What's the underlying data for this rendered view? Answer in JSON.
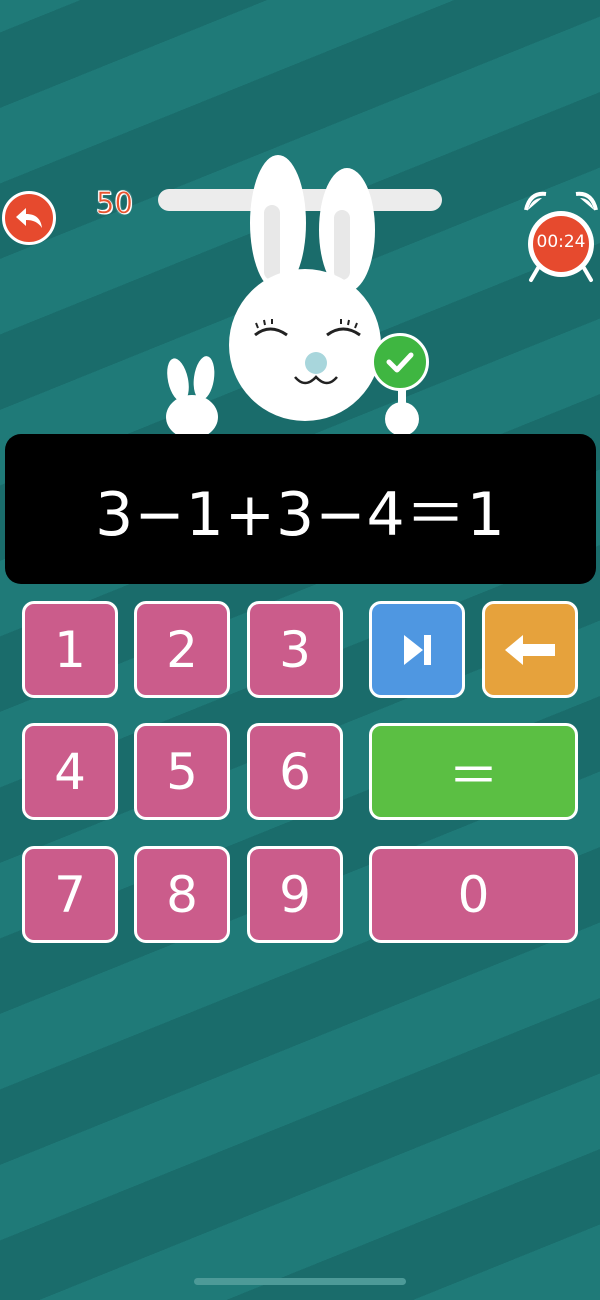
{
  "score": "50",
  "progress": 0.0,
  "timer": "00:24",
  "expression": "3−1+3−4＝1",
  "keys": {
    "k1": "1",
    "k2": "2",
    "k3": "3",
    "k4": "4",
    "k5": "5",
    "k6": "6",
    "k7": "7",
    "k8": "8",
    "k9": "9",
    "k0": "0",
    "equals": "＝"
  },
  "icons": {
    "back": "undo-arrow-icon",
    "skip": "skip-next-icon",
    "backspace": "left-arrow-icon",
    "timer": "alarm-clock-icon",
    "correct": "checkmark-icon",
    "mascot": "bunny-icon"
  },
  "colors": {
    "background": "#1f7a78",
    "digit_key": "#cb5c8b",
    "skip_key": "#4f97e1",
    "backspace_key": "#e6a23c",
    "equals_key": "#5bbf43",
    "accent": "#e64a2e"
  }
}
